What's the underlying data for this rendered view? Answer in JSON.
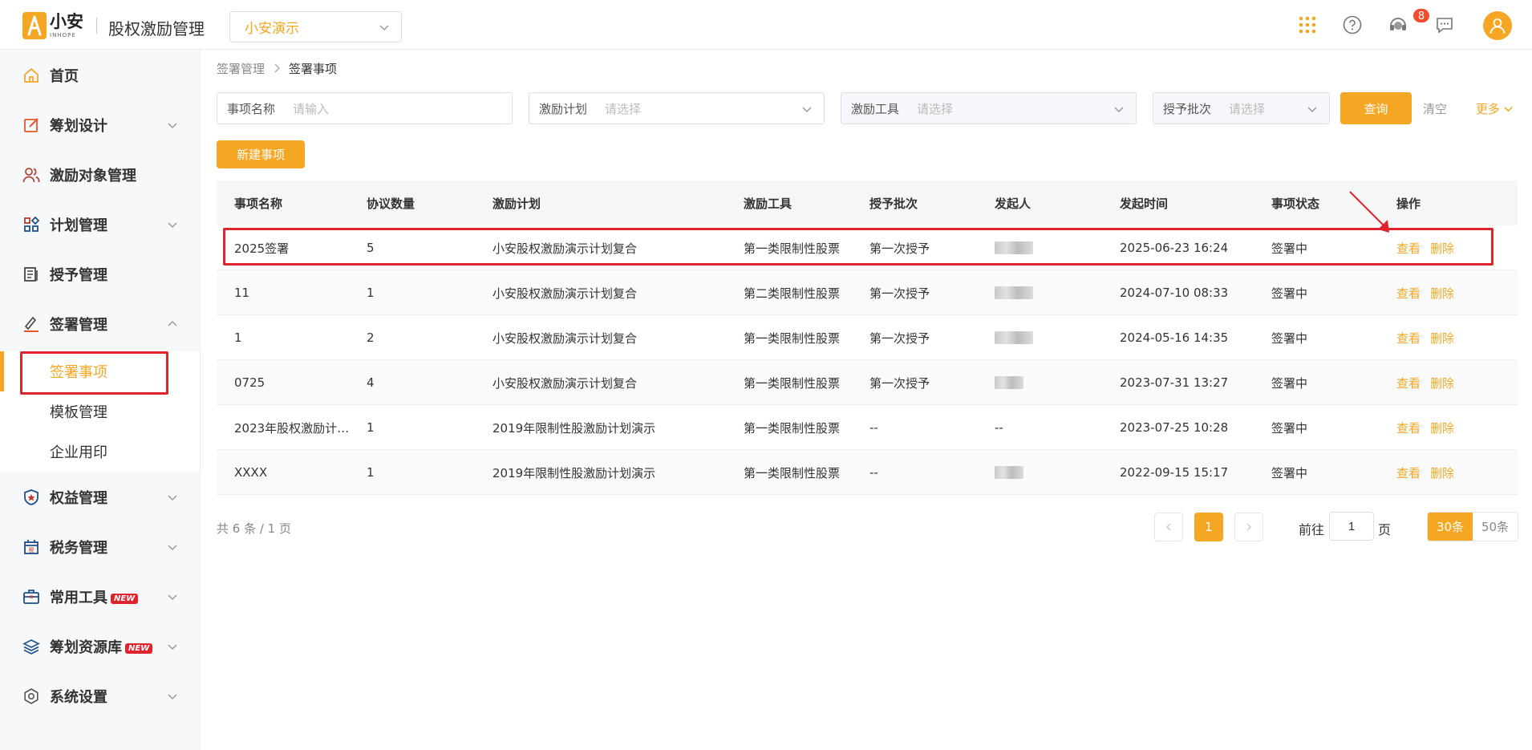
{
  "header": {
    "logo_cn": "小安",
    "logo_en": "INHOPE",
    "app_title": "股权激励管理",
    "company": "小安演示",
    "notification_count": "8"
  },
  "sidebar": {
    "items": [
      {
        "label": "首页",
        "icon": "home-icon"
      },
      {
        "label": "筹划设计",
        "icon": "edit-icon"
      },
      {
        "label": "激励对象管理",
        "icon": "users-icon"
      },
      {
        "label": "计划管理",
        "icon": "grid-icon"
      },
      {
        "label": "授予管理",
        "icon": "document-icon"
      },
      {
        "label": "签署管理",
        "icon": "signature-icon"
      },
      {
        "label": "权益管理",
        "icon": "badge-icon"
      },
      {
        "label": "税务管理",
        "icon": "tax-icon"
      },
      {
        "label": "常用工具",
        "icon": "toolbox-icon",
        "badge": "NEW"
      },
      {
        "label": "筹划资源库",
        "icon": "layers-icon",
        "badge": "NEW"
      },
      {
        "label": "系统设置",
        "icon": "settings-icon"
      }
    ],
    "sub_items": [
      {
        "label": "签署事项"
      },
      {
        "label": "模板管理"
      },
      {
        "label": "企业用印"
      }
    ]
  },
  "breadcrumb": {
    "parent": "签署管理",
    "current": "签署事项"
  },
  "filters": {
    "name_label": "事项名称",
    "name_placeholder": "请输入",
    "plan_label": "激励计划",
    "plan_placeholder": "请选择",
    "tool_label": "激励工具",
    "tool_placeholder": "请选择",
    "batch_label": "授予批次",
    "batch_placeholder": "请选择",
    "query": "查询",
    "clear": "清空",
    "more": "更多"
  },
  "toolbar": {
    "new_item": "新建事项"
  },
  "table": {
    "columns": [
      "事项名称",
      "协议数量",
      "激励计划",
      "激励工具",
      "授予批次",
      "发起人",
      "发起时间",
      "事项状态",
      "操作"
    ],
    "rows": [
      {
        "name": "2025签署",
        "count": "5",
        "plan": "小安股权激励演示计划复合",
        "tool": "第一类限制性股票",
        "batch": "第一次授予",
        "initiator": "",
        "time": "2025-06-23 16:24",
        "status": "签署中"
      },
      {
        "name": "11",
        "count": "1",
        "plan": "小安股权激励演示计划复合",
        "tool": "第二类限制性股票",
        "batch": "第一次授予",
        "initiator": "",
        "time": "2024-07-10 08:33",
        "status": "签署中"
      },
      {
        "name": "1",
        "count": "2",
        "plan": "小安股权激励演示计划复合",
        "tool": "第一类限制性股票",
        "batch": "第一次授予",
        "initiator": "",
        "time": "2024-05-16 14:35",
        "status": "签署中"
      },
      {
        "name": "0725",
        "count": "4",
        "plan": "小安股权激励演示计划复合",
        "tool": "第一类限制性股票",
        "batch": "第一次授予",
        "initiator": "",
        "time": "2023-07-31 13:27",
        "status": "签署中"
      },
      {
        "name": "2023年股权激励计…",
        "count": "1",
        "plan": "2019年限制性股激励计划演示",
        "tool": "第一类限制性股票",
        "batch": "--",
        "initiator": "--",
        "time": "2023-07-25 10:28",
        "status": "签署中"
      },
      {
        "name": "XXXX",
        "count": "1",
        "plan": "2019年限制性股激励计划演示",
        "tool": "第一类限制性股票",
        "batch": "--",
        "initiator": "",
        "time": "2022-09-15 15:17",
        "status": "签署中"
      }
    ],
    "action_view": "查看",
    "action_delete": "删除"
  },
  "pagination": {
    "total": "共 6 条 / 1 页",
    "current_page": "1",
    "goto_prefix": "前往",
    "goto_value": "1",
    "goto_suffix": "页",
    "size_30": "30条",
    "size_50": "50条"
  },
  "colors": {
    "accent": "#f5a623",
    "annotation": "#e0242e"
  }
}
